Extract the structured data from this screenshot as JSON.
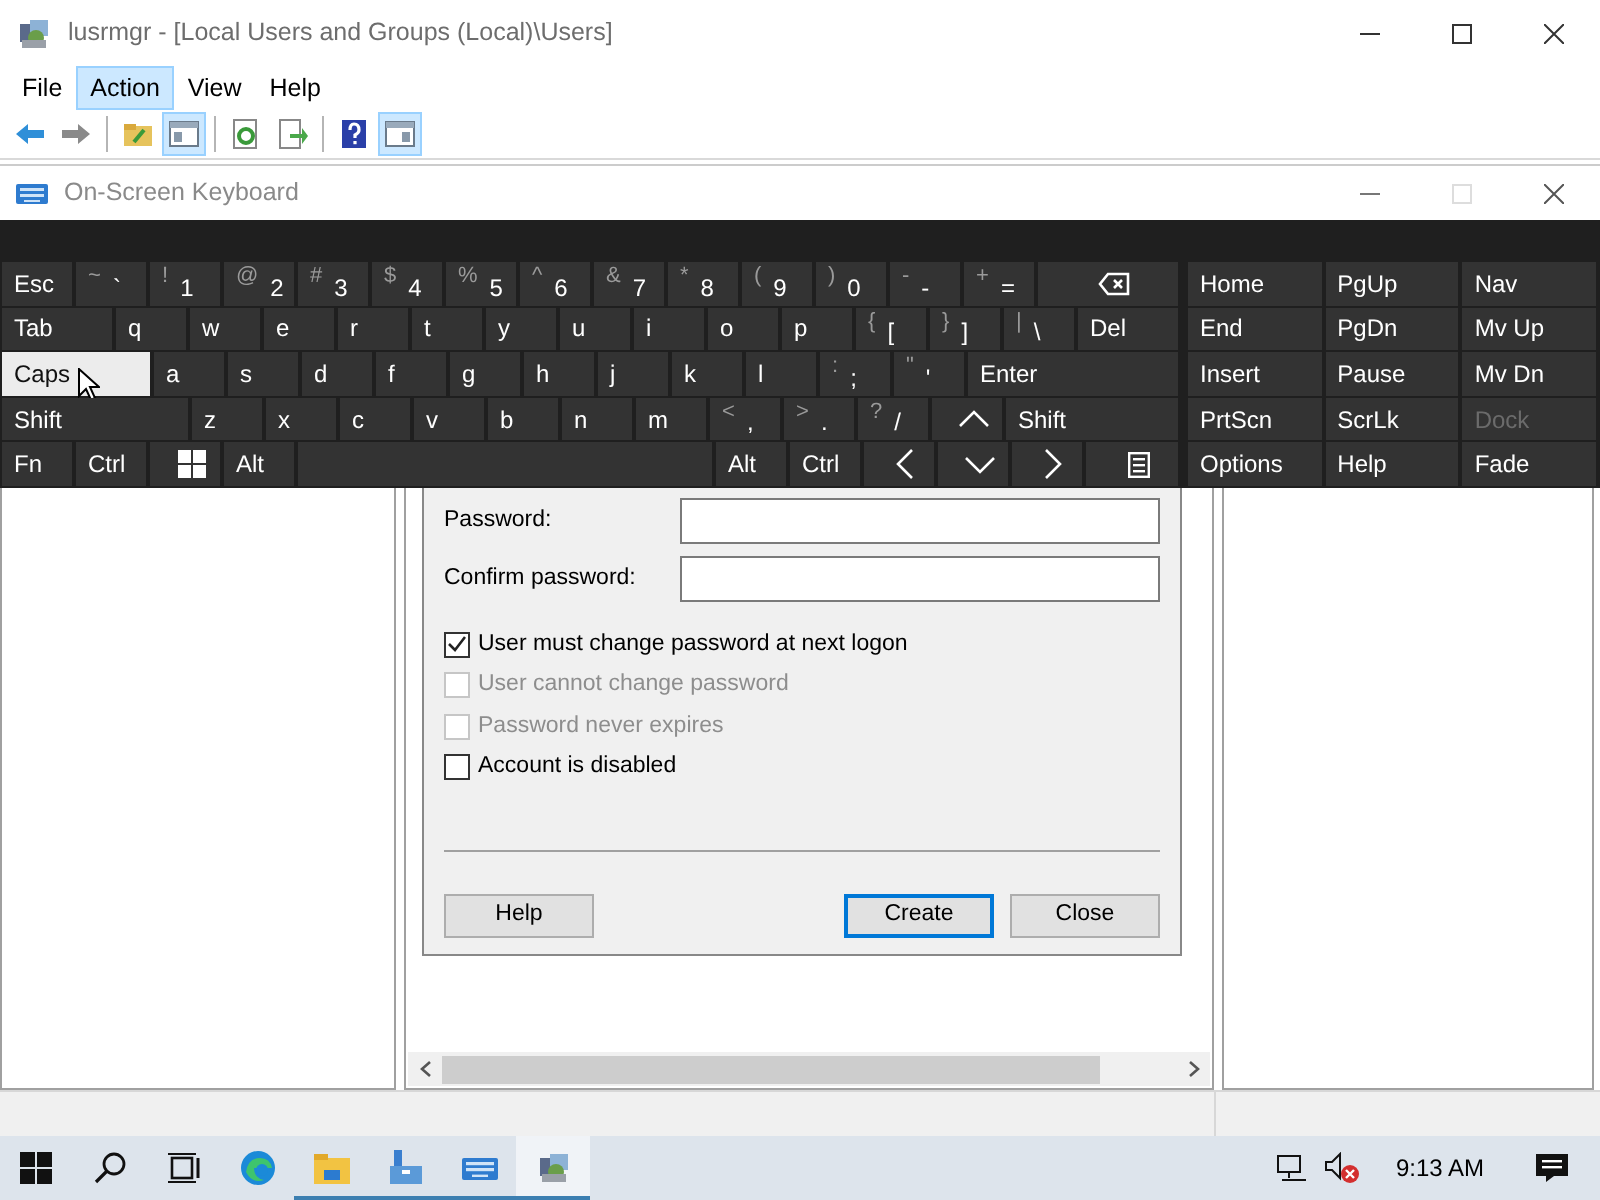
{
  "window": {
    "title": "lusrmgr - [Local Users and Groups (Local)\\Users]"
  },
  "menu": [
    {
      "label": "File",
      "selected": false
    },
    {
      "label": "Action",
      "selected": true
    },
    {
      "label": "View",
      "selected": false
    },
    {
      "label": "Help",
      "selected": false
    }
  ],
  "toolbar": [
    {
      "kind": "back",
      "pressed": false
    },
    {
      "kind": "forward",
      "pressed": false
    },
    {
      "kind": "separator"
    },
    {
      "kind": "up",
      "pressed": false
    },
    {
      "kind": "tree",
      "pressed": true
    },
    {
      "kind": "separator"
    },
    {
      "kind": "refresh",
      "pressed": false
    },
    {
      "kind": "export",
      "pressed": false
    },
    {
      "kind": "separator"
    },
    {
      "kind": "help",
      "pressed": false
    },
    {
      "kind": "actionpane",
      "pressed": true
    }
  ],
  "osk": {
    "title": "On-Screen Keyboard",
    "rows": [
      {
        "keys": [
          {
            "kind": "text",
            "label": "Esc",
            "highlighted": false
          },
          {
            "kind": "char",
            "shift": "~",
            "char": "`",
            "highlighted": false
          },
          {
            "kind": "char",
            "shift": "!",
            "char": "1",
            "highlighted": false
          },
          {
            "kind": "char",
            "shift": "@",
            "char": "2",
            "highlighted": false
          },
          {
            "kind": "char",
            "shift": "#",
            "char": "3",
            "highlighted": false
          },
          {
            "kind": "char",
            "shift": "$",
            "char": "4",
            "highlighted": false
          },
          {
            "kind": "char",
            "shift": "%",
            "char": "5",
            "highlighted": false
          },
          {
            "kind": "char",
            "shift": "^",
            "char": "6",
            "highlighted": false
          },
          {
            "kind": "char",
            "shift": "&",
            "char": "7",
            "highlighted": false
          },
          {
            "kind": "char",
            "shift": "*",
            "char": "8",
            "highlighted": false
          },
          {
            "kind": "char",
            "shift": "(",
            "char": "9",
            "highlighted": false
          },
          {
            "kind": "char",
            "shift": ")",
            "char": "0",
            "highlighted": false
          },
          {
            "kind": "char",
            "shift": "-",
            "char": "-",
            "highlighted": false
          },
          {
            "kind": "char",
            "shift": "+",
            "char": "=",
            "highlighted": false
          },
          {
            "kind": "backspace",
            "highlighted": false
          }
        ]
      },
      {
        "keys": [
          {
            "kind": "tab",
            "label": "Tab",
            "highlighted": false
          },
          {
            "kind": "text",
            "label": "q",
            "highlighted": false
          },
          {
            "kind": "text",
            "label": "w",
            "highlighted": false
          },
          {
            "kind": "text",
            "label": "e",
            "highlighted": false
          },
          {
            "kind": "text",
            "label": "r",
            "highlighted": false
          },
          {
            "kind": "text",
            "label": "t",
            "highlighted": false
          },
          {
            "kind": "text",
            "label": "y",
            "highlighted": false
          },
          {
            "kind": "text",
            "label": "u",
            "highlighted": false
          },
          {
            "kind": "text",
            "label": "i",
            "highlighted": false
          },
          {
            "kind": "text",
            "label": "o",
            "highlighted": false
          },
          {
            "kind": "text",
            "label": "p",
            "highlighted": false
          },
          {
            "kind": "char",
            "shift": "{",
            "char": "[",
            "highlighted": false
          },
          {
            "kind": "char",
            "shift": "}",
            "char": "]",
            "highlighted": false
          },
          {
            "kind": "char",
            "shift": "|",
            "char": "\\",
            "highlighted": false
          },
          {
            "kind": "text",
            "label": "Del",
            "highlighted": false
          }
        ]
      },
      {
        "keys": [
          {
            "kind": "caps",
            "label": "Caps",
            "highlighted": true
          },
          {
            "kind": "text",
            "label": "a",
            "highlighted": false
          },
          {
            "kind": "text",
            "label": "s",
            "highlighted": false
          },
          {
            "kind": "text",
            "label": "d",
            "highlighted": false
          },
          {
            "kind": "text",
            "label": "f",
            "highlighted": false
          },
          {
            "kind": "text",
            "label": "g",
            "highlighted": false
          },
          {
            "kind": "text",
            "label": "h",
            "highlighted": false
          },
          {
            "kind": "text",
            "label": "j",
            "highlighted": false
          },
          {
            "kind": "text",
            "label": "k",
            "highlighted": false
          },
          {
            "kind": "text",
            "label": "l",
            "highlighted": false
          },
          {
            "kind": "char",
            "shift": ":",
            "char": ";",
            "highlighted": false
          },
          {
            "kind": "char",
            "shift": "\"",
            "char": "'",
            "highlighted": false
          },
          {
            "kind": "text",
            "label": "Enter",
            "highlighted": false
          }
        ]
      },
      {
        "keys": [
          {
            "kind": "shift",
            "label": "Shift",
            "highlighted": false
          },
          {
            "kind": "text",
            "label": "z",
            "highlighted": false
          },
          {
            "kind": "text",
            "label": "x",
            "highlighted": false
          },
          {
            "kind": "text",
            "label": "c",
            "highlighted": false
          },
          {
            "kind": "text",
            "label": "v",
            "highlighted": false
          },
          {
            "kind": "text",
            "label": "b",
            "highlighted": false
          },
          {
            "kind": "text",
            "label": "n",
            "highlighted": false
          },
          {
            "kind": "text",
            "label": "m",
            "highlighted": false
          },
          {
            "kind": "char",
            "shift": "<",
            "char": ",",
            "highlighted": false
          },
          {
            "kind": "char",
            "shift": ">",
            "char": ".",
            "highlighted": false
          },
          {
            "kind": "char",
            "shift": "?",
            "char": "/",
            "highlighted": false
          },
          {
            "kind": "arrow-up",
            "highlighted": false
          },
          {
            "kind": "text",
            "label": "Shift",
            "highlighted": false
          }
        ]
      },
      {
        "keys": [
          {
            "kind": "text",
            "label": "Fn",
            "highlighted": false
          },
          {
            "kind": "text",
            "label": "Ctrl",
            "highlighted": false
          },
          {
            "kind": "windows",
            "highlighted": false
          },
          {
            "kind": "text",
            "label": "Alt",
            "highlighted": false
          },
          {
            "kind": "space",
            "highlighted": false
          },
          {
            "kind": "text",
            "label": "Alt",
            "highlighted": false
          },
          {
            "kind": "text",
            "label": "Ctrl",
            "highlighted": false
          },
          {
            "kind": "arrow-left",
            "highlighted": false
          },
          {
            "kind": "arrow-down",
            "highlighted": false
          },
          {
            "kind": "arrow-right",
            "highlighted": false
          },
          {
            "kind": "menu",
            "highlighted": false
          }
        ]
      }
    ],
    "nav": [
      [
        {
          "label": "Home",
          "disabled": false
        },
        {
          "label": "PgUp",
          "disabled": false
        },
        {
          "label": "Nav",
          "disabled": false
        }
      ],
      [
        {
          "label": "End",
          "disabled": false
        },
        {
          "label": "PgDn",
          "disabled": false
        },
        {
          "label": "Mv Up",
          "disabled": false
        }
      ],
      [
        {
          "label": "Insert",
          "disabled": false
        },
        {
          "label": "Pause",
          "disabled": false
        },
        {
          "label": "Mv Dn",
          "disabled": false
        }
      ],
      [
        {
          "label": "PrtScn",
          "disabled": false
        },
        {
          "label": "ScrLk",
          "disabled": false
        },
        {
          "label": "Dock",
          "disabled": true
        }
      ],
      [
        {
          "label": "Options",
          "disabled": false
        },
        {
          "label": "Help",
          "disabled": false
        },
        {
          "label": "Fade",
          "disabled": false
        }
      ]
    ]
  },
  "dialog": {
    "fields": [
      {
        "label": "Password:"
      },
      {
        "label": "Confirm password:"
      }
    ],
    "checkboxes": [
      {
        "label": "User must change password at next logon",
        "checked": true,
        "disabled": false
      },
      {
        "label": "User cannot change password",
        "checked": false,
        "disabled": true
      },
      {
        "label": "Password never expires",
        "checked": false,
        "disabled": true
      },
      {
        "label": "Account is disabled",
        "checked": false,
        "disabled": false
      }
    ],
    "buttons": [
      {
        "label": "Help",
        "default": false
      },
      {
        "label": "Create",
        "default": true
      },
      {
        "label": "Close",
        "default": false
      }
    ]
  },
  "taskbar": {
    "apps": [
      {
        "kind": "start",
        "running": false,
        "active": false
      },
      {
        "kind": "search",
        "running": false,
        "active": false
      },
      {
        "kind": "taskview",
        "running": false,
        "active": false
      },
      {
        "kind": "edge",
        "running": false,
        "active": false
      },
      {
        "kind": "explorer",
        "running": true,
        "active": false
      },
      {
        "kind": "servermgr",
        "running": true,
        "active": false
      },
      {
        "kind": "osk",
        "running": true,
        "active": false
      },
      {
        "kind": "lusrmgr",
        "running": true,
        "active": true
      }
    ],
    "clock": "9:13 AM"
  }
}
